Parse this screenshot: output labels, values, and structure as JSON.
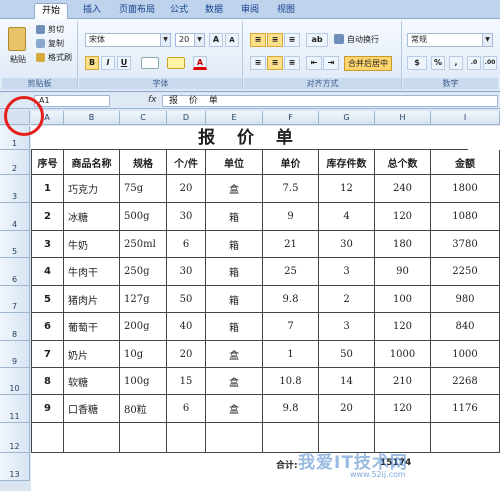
{
  "tabs": [
    "开始",
    "插入",
    "页面布局",
    "公式",
    "数据",
    "审阅",
    "视图"
  ],
  "clipboard": {
    "paste": "粘贴",
    "cut": "剪切",
    "copy": "复制",
    "format_painter": "格式刷",
    "label": "剪贴板"
  },
  "font": {
    "name": "宋体",
    "size": "20",
    "grow": "A",
    "shrink": "A",
    "bold": "B",
    "italic": "I",
    "underline": "U",
    "font_color": "A",
    "label": "字体"
  },
  "alignment": {
    "wrap": "自动换行",
    "merge": "合并后居中",
    "label": "对齐方式"
  },
  "number": {
    "format": "常规",
    "currency": "$",
    "percent": "%",
    "comma": ",",
    "label": "数字"
  },
  "formula_bar": {
    "cell_ref": "A1",
    "fx": "fx",
    "content": "报 价 单"
  },
  "columns": [
    "A",
    "B",
    "C",
    "D",
    "E",
    "F",
    "G",
    "H",
    "I"
  ],
  "rows": [
    "1",
    "2",
    "3",
    "4",
    "5",
    "6",
    "7",
    "8",
    "9",
    "10",
    "11",
    "12",
    "13"
  ],
  "sheet": {
    "title": "报 价 单",
    "headers": [
      "序号",
      "商品名称",
      "规格",
      "个/件",
      "单位",
      "单价",
      "库存件数",
      "总个数",
      "金额"
    ],
    "data": [
      [
        "1",
        "巧克力",
        "75g",
        "20",
        "盒",
        "7.5",
        "12",
        "240",
        "1800"
      ],
      [
        "2",
        "冰糖",
        "500g",
        "30",
        "箱",
        "9",
        "4",
        "120",
        "1080"
      ],
      [
        "3",
        "牛奶",
        "250ml",
        "6",
        "箱",
        "21",
        "30",
        "180",
        "3780"
      ],
      [
        "4",
        "牛肉干",
        "250g",
        "30",
        "箱",
        "25",
        "3",
        "90",
        "2250"
      ],
      [
        "5",
        "猪肉片",
        "127g",
        "50",
        "箱",
        "9.8",
        "2",
        "100",
        "980"
      ],
      [
        "6",
        "葡萄干",
        "200g",
        "40",
        "箱",
        "7",
        "3",
        "120",
        "840"
      ],
      [
        "7",
        "奶片",
        "10g",
        "20",
        "盒",
        "1",
        "50",
        "1000",
        "1000"
      ],
      [
        "8",
        "软糖",
        "100g",
        "15",
        "盒",
        "10.8",
        "14",
        "210",
        "2268"
      ],
      [
        "9",
        "口香糖",
        "80粒",
        "6",
        "盒",
        "9.8",
        "20",
        "120",
        "1176"
      ]
    ],
    "total_label": "合计:",
    "total_value": "15174"
  },
  "watermark": {
    "main": "我爱IT技术网",
    "sub": "www.52ij.com"
  }
}
